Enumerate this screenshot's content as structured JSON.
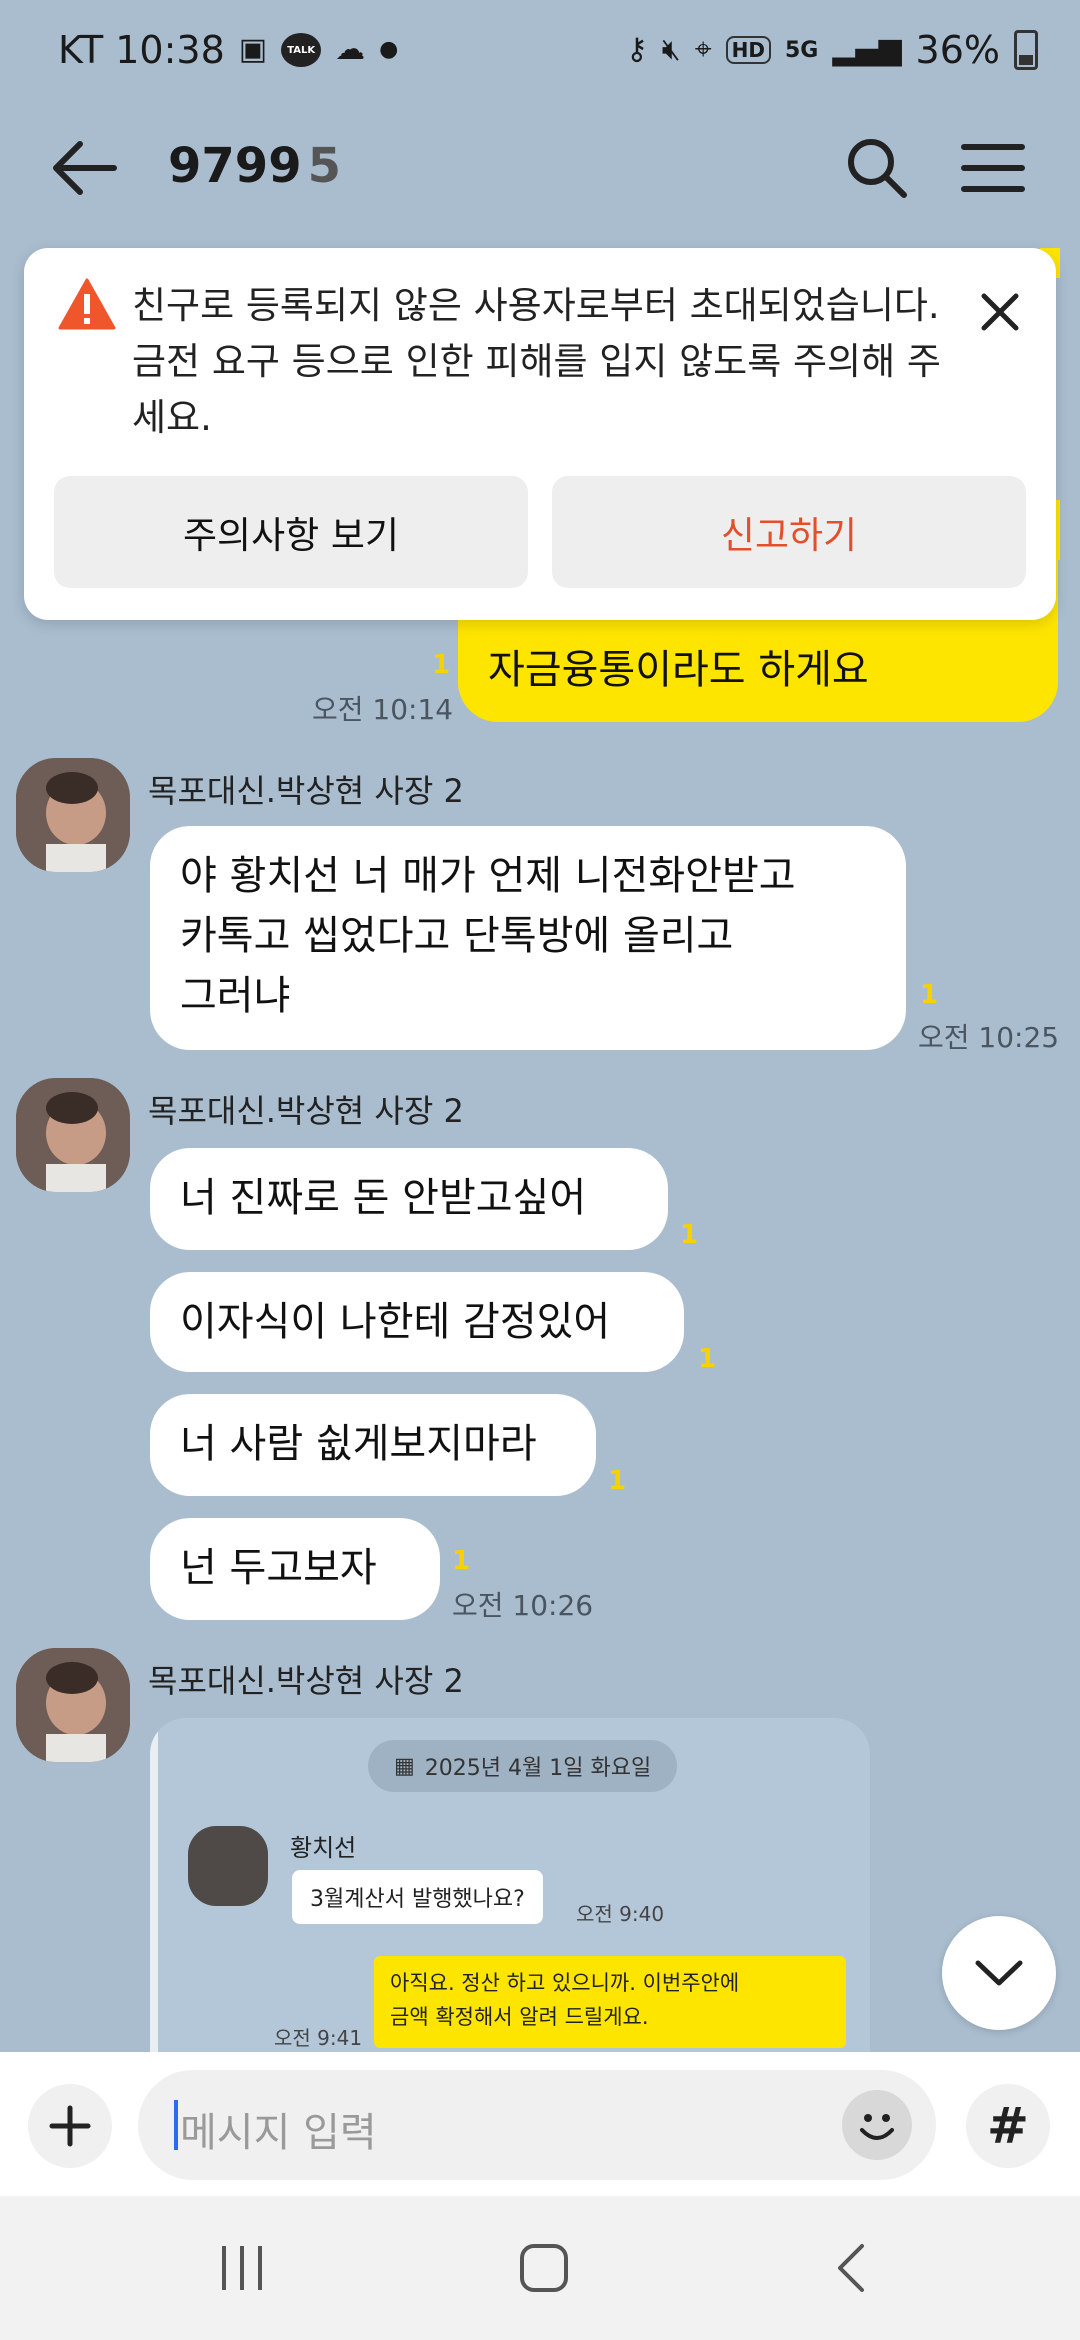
{
  "status_bar": {
    "carrier_time": "KT 10:38",
    "talk_label": "TALK",
    "network": "5G",
    "hd": "HD",
    "battery": "36%"
  },
  "header": {
    "title": "9799",
    "member_count": "5"
  },
  "alert": {
    "message": "친구로 등록되지 않은 사용자로부터 초대되었습니다. 금전 요구 등으로 인한 피해를 입지 않도록 주의해 주세요.",
    "view_button": "주의사항 보기",
    "report_button": "신고하기"
  },
  "messages": {
    "mine_top": {
      "text": "자금융통이라도 하게요",
      "unread": "1",
      "time": "오전 10:14"
    },
    "sender": "목포대신.박상현 사장 2",
    "group1": {
      "text_line1": "야 황치선  너   매가 언제 니전화안받고",
      "text_line2": "카톡고 씹었다고  단톡방에  올리고",
      "text_line3": "그러냐",
      "unread": "1",
      "time": "오전 10:25"
    },
    "group2": [
      {
        "text": "너  진짜로  돈 안받고싶어",
        "unread": "1"
      },
      {
        "text": "이자식이  나한테 감정있어",
        "unread": "1"
      },
      {
        "text": "너 사람  쉾게보지마라",
        "unread": "1"
      },
      {
        "text": "넌 두고보자",
        "unread": "1"
      }
    ],
    "group2_time": "오전 10:26",
    "shared": {
      "date": "2025년 4월 1일 화요일",
      "name": "황치선",
      "q_text": "3월계산서 발행했나요?",
      "q_time": "오전 9:40",
      "a_line1": "아직요. 정산 하고 있으니까. 이번주안에",
      "a_line2": "금액 확정해서 알려 드릴게요.",
      "a_time": "오전 9:41"
    }
  },
  "input": {
    "placeholder": "메시지 입력"
  },
  "colors": {
    "background": "#a9bdcf",
    "my_bubble": "#fee500",
    "report": "#e1502a",
    "alert_icon": "#f0562b"
  }
}
